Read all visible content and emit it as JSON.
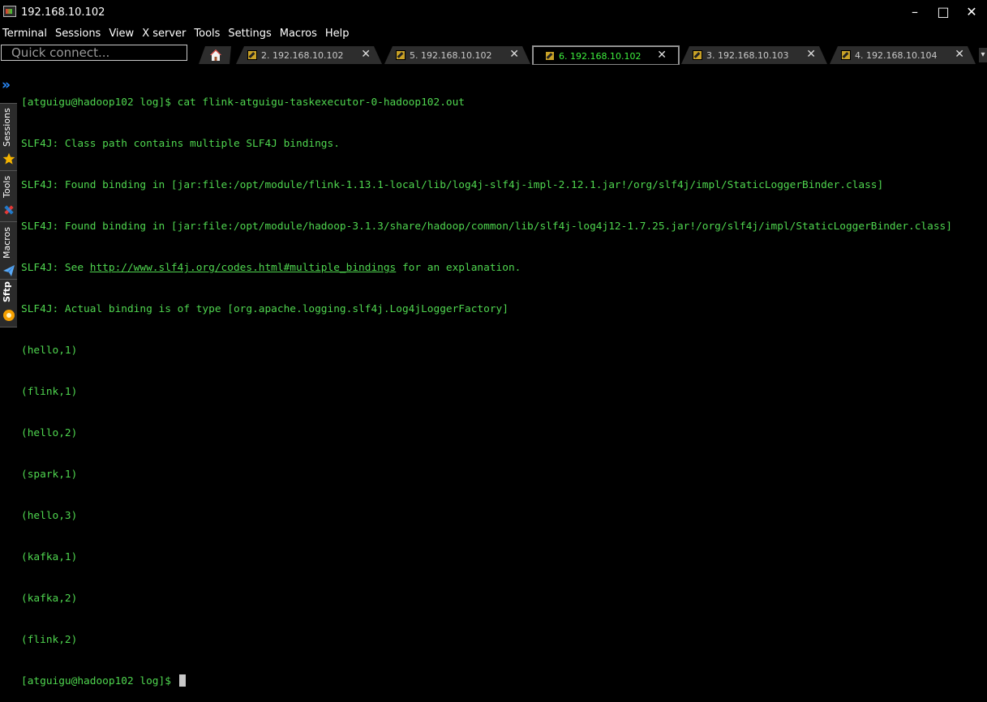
{
  "window": {
    "title": "192.168.10.102"
  },
  "menu": [
    "Terminal",
    "Sessions",
    "View",
    "X server",
    "Tools",
    "Settings",
    "Macros",
    "Help"
  ],
  "quick_connect": {
    "placeholder": "Quick connect..."
  },
  "tabs": [
    {
      "label": "2. 192.168.10.102",
      "active": false
    },
    {
      "label": "5. 192.168.10.102",
      "active": false
    },
    {
      "label": "6. 192.168.10.102",
      "active": true
    },
    {
      "label": "3. 192.168.10.103",
      "active": false
    },
    {
      "label": "4. 192.168.10.104",
      "active": false
    }
  ],
  "sidebar": {
    "sessions": "Sessions",
    "tools": "Tools",
    "macros": "Macros",
    "sftp": "Sftp"
  },
  "colors": {
    "terminal_text": "#4fd64f",
    "active_tab_text": "#3ef03e",
    "accent_blue": "#2a8cff"
  },
  "terminal": {
    "lines": [
      "[atguigu@hadoop102 log]$ cat flink-atguigu-taskexecutor-0-hadoop102.out",
      "SLF4J: Class path contains multiple SLF4J bindings.",
      "SLF4J: Found binding in [jar:file:/opt/module/flink-1.13.1-local/lib/log4j-slf4j-impl-2.12.1.jar!/org/slf4j/impl/StaticLoggerBinder.class]",
      "SLF4J: Found binding in [jar:file:/opt/module/hadoop-3.1.3/share/hadoop/common/lib/slf4j-log4j12-1.7.25.jar!/org/slf4j/impl/StaticLoggerBinder.class]",
      {
        "before": "SLF4J: See ",
        "link": "http://www.slf4j.org/codes.html#multiple_bindings",
        "after": " for an explanation."
      },
      "SLF4J: Actual binding is of type [org.apache.logging.slf4j.Log4jLoggerFactory]",
      "(hello,1)",
      "(flink,1)",
      "(hello,2)",
      "(spark,1)",
      "(hello,3)",
      "(kafka,1)",
      "(kafka,2)",
      "(flink,2)"
    ],
    "prompt": "[atguigu@hadoop102 log]$ "
  }
}
